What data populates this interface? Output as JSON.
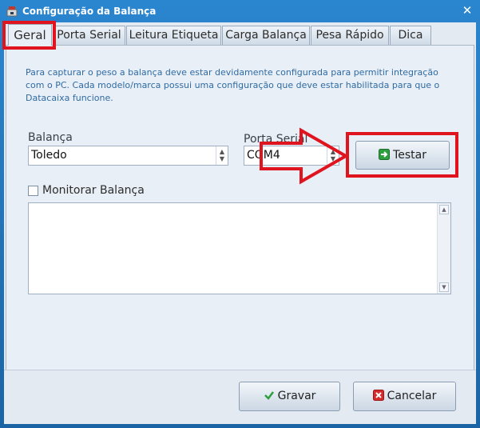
{
  "window": {
    "title": "Configuração da Balança",
    "close_symbol": "✕",
    "icon": "scale-app-icon"
  },
  "tabs": [
    {
      "label": "Geral",
      "active": true
    },
    {
      "label": "Porta Serial",
      "active": false
    },
    {
      "label": "Leitura Etiqueta",
      "active": false
    },
    {
      "label": "Carga Balança",
      "active": false
    },
    {
      "label": "Pesa Rápido",
      "active": false
    },
    {
      "label": "Dica",
      "active": false
    }
  ],
  "general": {
    "description": "Para capturar o peso a balança deve estar devidamente configurada para permitir integração com o PC. Cada modelo/marca possui uma configuração que deve estar habilitada para que o Datacaixa funcione.",
    "balanca_label": "Balança",
    "balanca_value": "Toledo",
    "porta_label": "Porta Serial",
    "porta_value": "COM4",
    "test_button": "Testar",
    "monitor_label": "Monitorar Balança",
    "monitor_checked": false,
    "memo_text": ""
  },
  "footer": {
    "save_button": "Gravar",
    "cancel_button": "Cancelar"
  },
  "colors": {
    "window_frame": "#1f6fb0",
    "annotation_red": "#e0141e",
    "description_text": "#2f6ba3"
  }
}
